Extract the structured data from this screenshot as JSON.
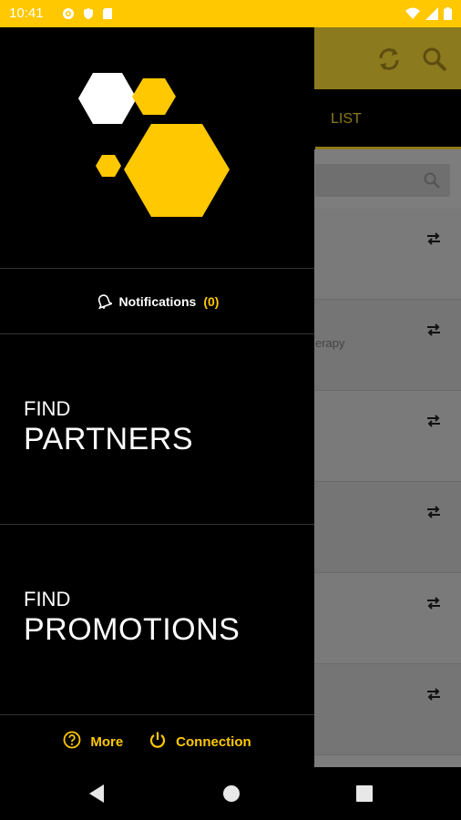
{
  "status_bar": {
    "time": "10:41",
    "left_icons": [
      "settings-icon",
      "shield-icon",
      "sd-card-icon"
    ],
    "right_icons": [
      "wifi-icon",
      "cellular-icon",
      "battery-icon"
    ]
  },
  "background_app": {
    "toolbar_icons": [
      "refresh-icon",
      "search-icon"
    ],
    "active_tab": "LIST",
    "search_icon": "search-icon",
    "list_rows": [
      {
        "subtitle": "",
        "icon": "swap-icon"
      },
      {
        "subtitle": "erapy",
        "icon": "swap-icon"
      },
      {
        "subtitle": "",
        "icon": "swap-icon"
      },
      {
        "subtitle": "",
        "icon": "swap-icon"
      },
      {
        "subtitle": "",
        "icon": "swap-icon"
      },
      {
        "subtitle": "",
        "icon": "swap-icon"
      }
    ]
  },
  "drawer": {
    "logo": "hexagon-logo",
    "notifications": {
      "label": "Notifications",
      "count": "(0)",
      "icon": "bell-icon"
    },
    "find_partners": {
      "small": "FIND",
      "big": "PARTNERS"
    },
    "find_promotions": {
      "small": "FIND",
      "big": "PROMOTIONS"
    },
    "footer": {
      "more_label": "More",
      "more_icon": "help-circle-icon",
      "connection_label": "Connection",
      "connection_icon": "power-icon"
    }
  },
  "nav_bar": {
    "buttons": [
      "back-icon",
      "home-icon",
      "recents-icon"
    ]
  },
  "colors": {
    "accent": "#ffc800",
    "drawer_bg": "#000000",
    "scrim_app": "#7d7d7d"
  }
}
